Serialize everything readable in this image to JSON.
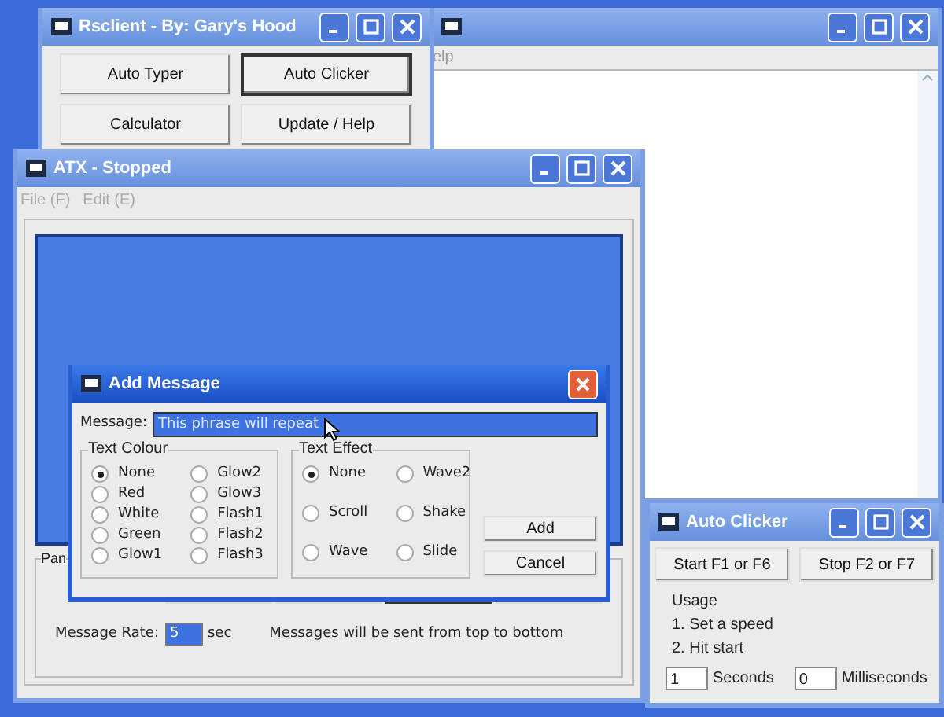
{
  "back_window": {
    "active": false,
    "menu": [
      "elp"
    ]
  },
  "rsclient_window": {
    "title": "Rsclient - By: Gary's Hood",
    "active": false,
    "buttons": [
      {
        "label": "Auto Typer",
        "default": false
      },
      {
        "label": "Auto Clicker",
        "default": true
      },
      {
        "label": "Calculator",
        "default": false
      },
      {
        "label": "Update / Help",
        "default": false
      }
    ]
  },
  "atx_window": {
    "title": "ATX - Stopped",
    "active": false,
    "menu": [
      {
        "label": "File (F)",
        "disabled": true
      },
      {
        "label": "Edit (E)",
        "disabled": true
      }
    ],
    "panel_label": "Pan",
    "buttons": [
      {
        "default": false
      },
      {
        "default": false
      },
      {
        "default": true
      },
      {
        "default": false
      }
    ],
    "rate_label": "Message Rate:",
    "rate_value": "5",
    "rate_unit": "sec",
    "note": "Messages will be sent from top to bottom"
  },
  "auto_clicker_window": {
    "title": "Auto Clicker",
    "active": false,
    "buttons": [
      "Start F1 or F6",
      "Stop F2 or F7"
    ],
    "usage": [
      "Usage",
      "1. Set a speed",
      "2. Hit start"
    ],
    "fields": [
      {
        "value": "1",
        "unit": "Seconds"
      },
      {
        "value": "0",
        "unit": "Milliseconds"
      }
    ]
  },
  "add_message_dialog": {
    "title": "Add Message",
    "active": true,
    "message_label": "Message:",
    "message_value": "This phrase will repeat",
    "groups": [
      {
        "title": "Text Colour",
        "options": [
          {
            "label": "None",
            "selected": true
          },
          {
            "label": "Red",
            "selected": false
          },
          {
            "label": "White",
            "selected": false
          },
          {
            "label": "Green",
            "selected": false
          },
          {
            "label": "Glow1",
            "selected": false
          },
          {
            "label": "Glow2",
            "selected": false
          },
          {
            "label": "Glow3",
            "selected": false
          },
          {
            "label": "Flash1",
            "selected": false
          },
          {
            "label": "Flash2",
            "selected": false
          },
          {
            "label": "Flash3",
            "selected": false
          }
        ]
      },
      {
        "title": "Text Effect",
        "options": [
          {
            "label": "None",
            "selected": true
          },
          {
            "label": "Scroll",
            "selected": false
          },
          {
            "label": "Wave",
            "selected": false
          },
          {
            "label": "Wave2",
            "selected": false
          },
          {
            "label": "Shake",
            "selected": false
          },
          {
            "label": "Slide",
            "selected": false
          }
        ]
      }
    ],
    "buttons": [
      "Add",
      "Cancel"
    ]
  }
}
